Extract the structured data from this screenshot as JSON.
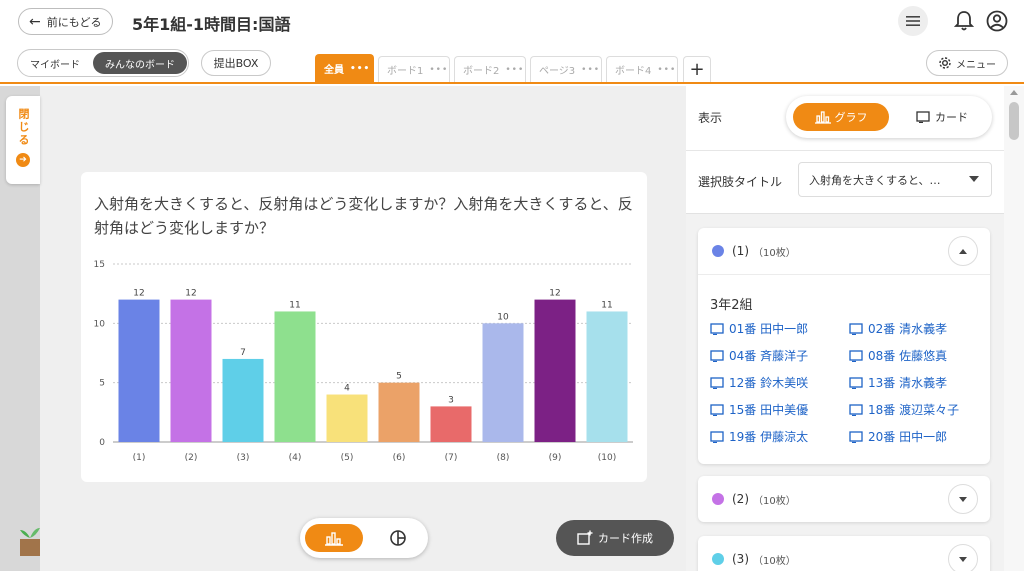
{
  "header": {
    "back_label": "前にもどる",
    "title": "5年1組-1時間目:国語"
  },
  "board_switch": {
    "my_board": "マイボード",
    "everyone_board": "みんなのボード"
  },
  "submit_box": "提出BOX",
  "tabs": [
    {
      "label": "全員",
      "active": true
    },
    {
      "label": "ボード1",
      "active": false
    },
    {
      "label": "ボード2",
      "active": false
    },
    {
      "label": "ページ3",
      "active": false
    },
    {
      "label": "ボード4",
      "active": false
    }
  ],
  "tab_add": "+",
  "menu_label": "メニュー",
  "close_tab": "閉じる",
  "question": "入射角を大きくすると、反射角はどう変化しますか？入射角を大きくすると、反射角はどう変化しますか？",
  "chart_data": {
    "type": "bar",
    "categories": [
      "(1)",
      "(2)",
      "(3)",
      "(4)",
      "(5)",
      "(6)",
      "(7)",
      "(8)",
      "(9)",
      "(10)"
    ],
    "values": [
      12,
      12,
      7,
      11,
      4,
      5,
      3,
      10,
      12,
      11
    ],
    "colors": [
      "#6a83e6",
      "#c472e6",
      "#5fcfe8",
      "#8ee08e",
      "#f8e17a",
      "#eba268",
      "#e86a6a",
      "#aab8eb",
      "#7c2185",
      "#a6e0ec"
    ],
    "ylim": [
      0,
      15
    ],
    "yticks": [
      0,
      5,
      10,
      15
    ],
    "grid": true,
    "data_labels": true
  },
  "view_toggle": {
    "graph_icon": "bar-chart-icon",
    "pie_icon": "pie-chart-icon"
  },
  "card_create_label": "カード作成",
  "panel": {
    "display_label": "表示",
    "graph_label": "グラフ",
    "card_label": "カード",
    "choice_title_label": "選択肢タイトル",
    "choice_title_value": "入射角を大きくすると、…",
    "options": [
      {
        "label": "(1)",
        "count": "（10枚）",
        "color": "#6a83e6",
        "expanded": true
      },
      {
        "label": "(2)",
        "count": "（10枚）",
        "color": "#c472e6",
        "expanded": false
      },
      {
        "label": "(3)",
        "count": "（10枚）",
        "color": "#5fcfe8",
        "expanded": false
      }
    ],
    "class_name": "3年2組",
    "students": [
      "01番 田中一郎",
      "02番 清水義孝",
      "04番 斉藤洋子",
      "08番 佐藤悠真",
      "12番 鈴木美咲",
      "13番 清水義孝",
      "15番 田中美優",
      "18番 渡辺菜々子",
      "19番 伊藤涼太",
      "20番 田中一郎"
    ]
  }
}
